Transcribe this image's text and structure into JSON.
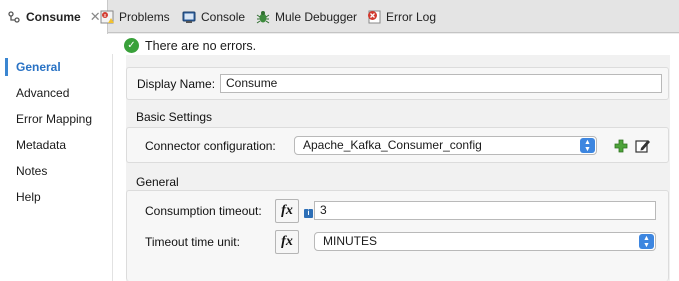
{
  "tabs": [
    {
      "label": "Consume",
      "icon": "mule-flow-icon",
      "active": true,
      "closable": true
    },
    {
      "label": "Problems",
      "icon": "problems-icon"
    },
    {
      "label": "Console",
      "icon": "console-icon"
    },
    {
      "label": "Mule Debugger",
      "icon": "debugger-bug-icon"
    },
    {
      "label": "Error Log",
      "icon": "error-log-icon"
    }
  ],
  "status": {
    "text": "There are no errors.",
    "icon": "check-circle-icon",
    "color": "#39a13a"
  },
  "sidebar": {
    "items": [
      {
        "label": "General",
        "active": true
      },
      {
        "label": "Advanced"
      },
      {
        "label": "Error Mapping"
      },
      {
        "label": "Metadata"
      },
      {
        "label": "Notes"
      },
      {
        "label": "Help"
      }
    ],
    "accent": "#2a73c5"
  },
  "form": {
    "display_name": {
      "label": "Display Name:",
      "value": "Consume"
    },
    "basic_settings": {
      "title": "Basic Settings",
      "connector_configuration": {
        "label": "Connector configuration:",
        "value": "Apache_Kafka_Consumer_config"
      },
      "add_icon": "plus-icon",
      "edit_icon": "edit-icon"
    },
    "general": {
      "title": "General",
      "consumption_timeout": {
        "label": "Consumption timeout:",
        "value": "3",
        "fx": "fx",
        "info": "i"
      },
      "timeout_time_unit": {
        "label": "Timeout time unit:",
        "value": "MINUTES",
        "fx": "fx"
      }
    }
  }
}
